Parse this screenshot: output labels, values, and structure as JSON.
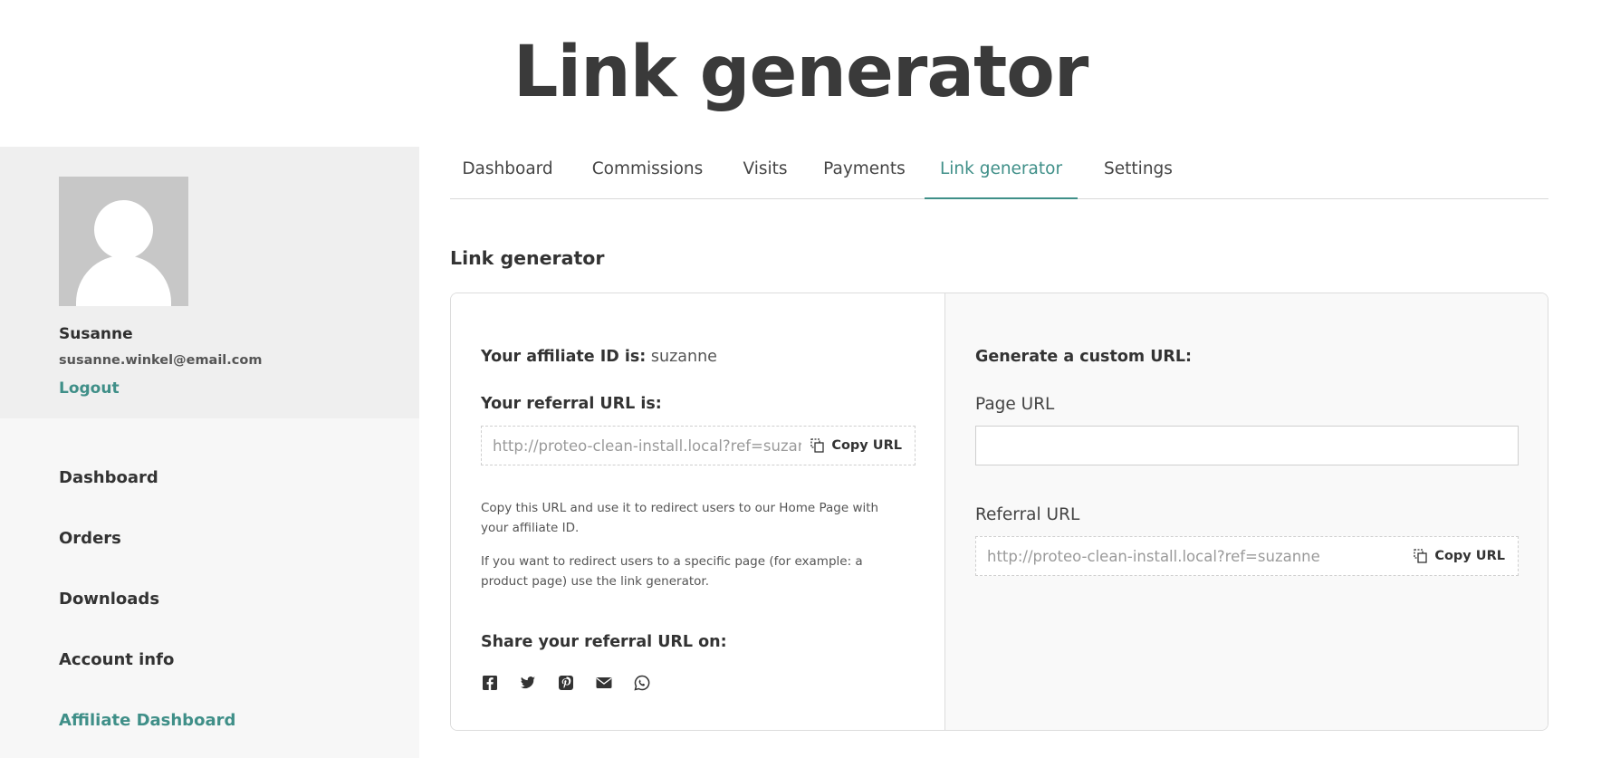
{
  "page": {
    "title": "Link generator"
  },
  "user": {
    "name": "Susanne",
    "email": "susanne.winkel@email.com",
    "logout_label": "Logout"
  },
  "sidebar": {
    "items": [
      {
        "label": "Dashboard"
      },
      {
        "label": "Orders"
      },
      {
        "label": "Downloads"
      },
      {
        "label": "Account info"
      },
      {
        "label": "Affiliate Dashboard",
        "active": true
      }
    ]
  },
  "tabs": [
    {
      "label": "Dashboard"
    },
    {
      "label": "Commissions"
    },
    {
      "label": "Visits"
    },
    {
      "label": "Payments"
    },
    {
      "label": "Link generator",
      "active": true
    },
    {
      "label": "Settings"
    }
  ],
  "section": {
    "title": "Link generator"
  },
  "left": {
    "affiliate_label": "Your affiliate ID is:",
    "affiliate_id": "suzanne",
    "referral_label": "Your referral URL is:",
    "referral_url": "http://proteo-clean-install.local?ref=suzanne",
    "copy_label": "Copy URL",
    "help1": "Copy this URL and use it to redirect users to our Home Page with your affiliate ID.",
    "help2": "If you want to redirect users to a specific page (for example: a product page) use the link generator.",
    "share_label": "Share your referral URL on:",
    "social": [
      "facebook-icon",
      "twitter-icon",
      "pinterest-icon",
      "email-icon",
      "whatsapp-icon"
    ]
  },
  "right": {
    "title": "Generate a custom URL:",
    "page_url_label": "Page URL",
    "page_url_value": "",
    "page_url_placeholder": "",
    "referral_url_label": "Referral URL",
    "referral_url": "http://proteo-clean-install.local?ref=suzanne",
    "copy_label": "Copy URL"
  },
  "colors": {
    "accent": "#3f8f88",
    "sidebar_bg": "#f7f7f7",
    "profile_bg": "#efefef"
  }
}
